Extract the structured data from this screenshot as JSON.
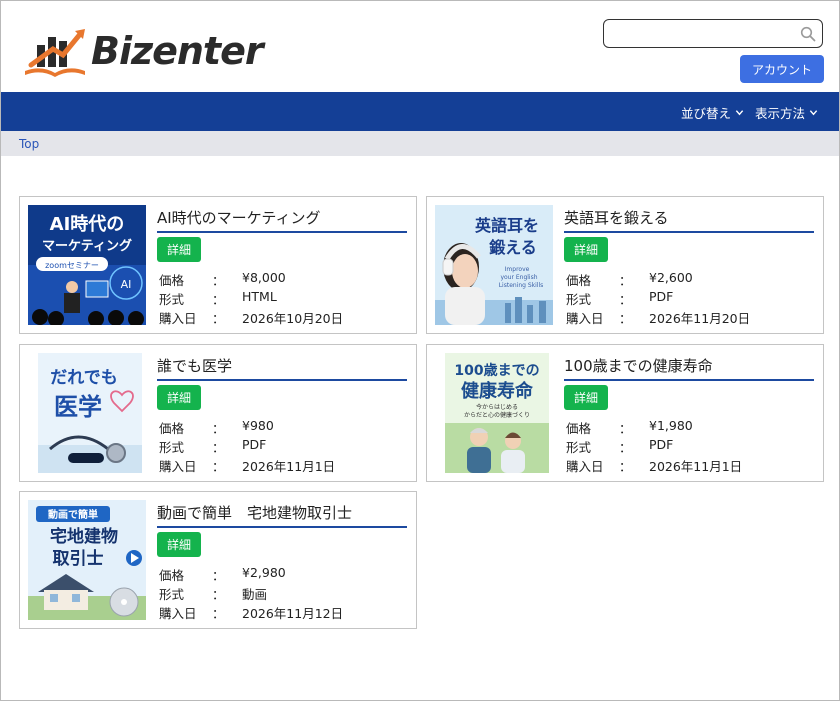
{
  "header": {
    "brand": "Bizenter",
    "search": {
      "value": "",
      "placeholder": ""
    },
    "account_label": "アカウント"
  },
  "nav": {
    "sort_label": "並び替え",
    "view_label": "表示方法"
  },
  "breadcrumb": {
    "top": "Top"
  },
  "labels": {
    "detail": "詳細",
    "price": "価格",
    "format": "形式",
    "date": "購入日",
    "sep": "："
  },
  "items": [
    {
      "title": "AI時代のマーケティング",
      "price": "¥8,000",
      "format": "HTML",
      "date": "2026年10月20日",
      "thumb_lines": [
        "AI時代の",
        "マーケティング"
      ],
      "thumb_badge": "zoomセミナー",
      "thumb_ai": "AI"
    },
    {
      "title": "英語耳を鍛える",
      "price": "¥2,600",
      "format": "PDF",
      "date": "2026年11月20日",
      "thumb_lines": [
        "英語耳を",
        "鍛える"
      ],
      "thumb_sub": [
        "Improve",
        "your English",
        "Listening Skills"
      ]
    },
    {
      "title": "誰でも医学",
      "price": "¥980",
      "format": "PDF",
      "date": "2026年11月1日",
      "thumb_lines": [
        "だれでも",
        "医学"
      ]
    },
    {
      "title": "100歳までの健康寿命",
      "price": "¥1,980",
      "format": "PDF",
      "date": "2026年11月1日",
      "thumb_lines": [
        "100歳までの",
        "健康寿命"
      ],
      "thumb_sub": [
        "今からはじめる",
        "からだと心の健康づくり"
      ]
    },
    {
      "title": "動画で簡単　宅地建物取引士",
      "price": "¥2,980",
      "format": "動画",
      "date": "2026年11月12日",
      "thumb_lines": [
        "宅地建物",
        "取引士"
      ],
      "thumb_badge": "動画で簡単"
    }
  ],
  "colors": {
    "nav": "#143f96",
    "account_button": "#3d6fe2",
    "detail_button": "#14b34d",
    "title_rule": "#1d4aa0",
    "breadcrumb_bg": "#e4e5ea"
  }
}
